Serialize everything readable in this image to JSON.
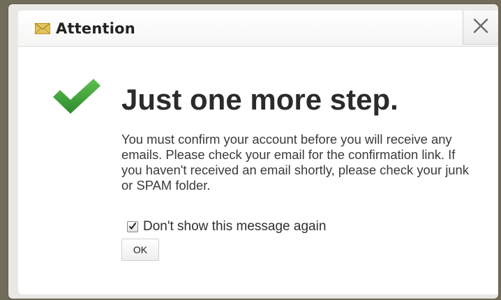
{
  "dialog": {
    "title": "Attention",
    "title_icon": "mail-icon",
    "close_icon": "close-icon",
    "close_symbol": "✕",
    "status_icon": "checkmark-icon",
    "headline": "Just one more step.",
    "message": "You must confirm your account before you will receive any emails. Please check your email for the confirmation link. If you haven't received an email shortly, please check your junk or SPAM folder.",
    "dont_show_label": "Don't show this message again",
    "dont_show_checked": true,
    "ok_label": "OK"
  },
  "colors": {
    "check_green": "#3e9b3a",
    "mail_yellow": "#d9b84a",
    "backdrop": "#716c59"
  }
}
